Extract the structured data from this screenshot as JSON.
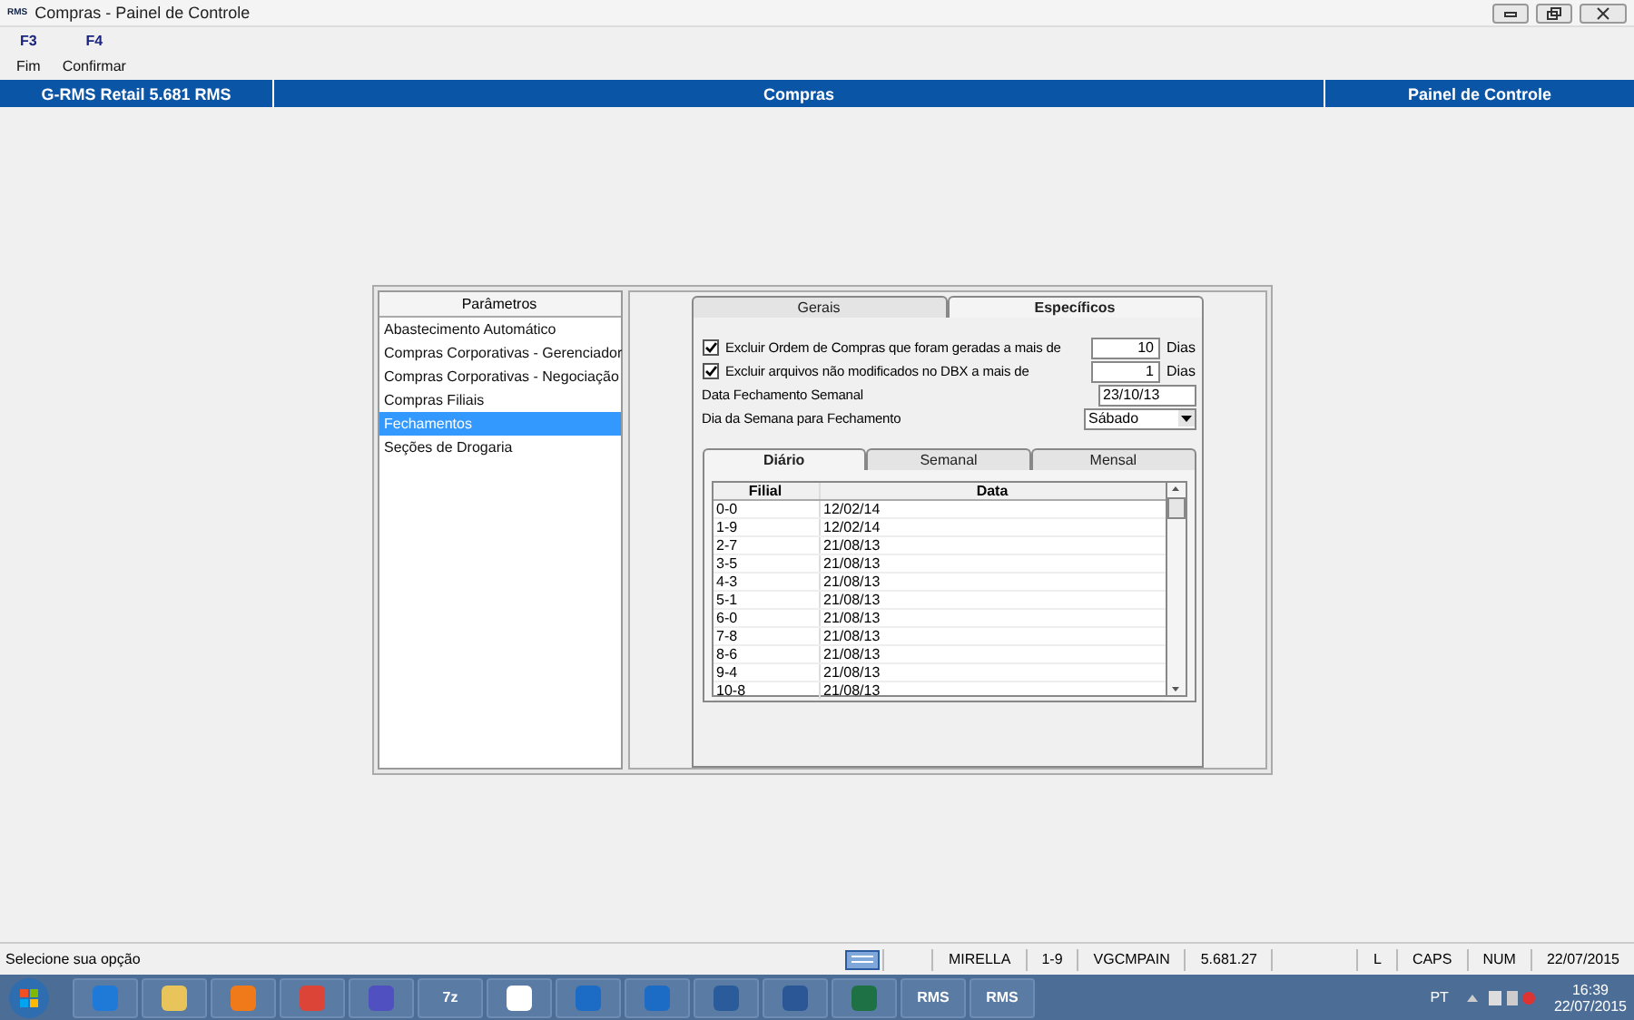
{
  "window": {
    "title": "Compras - Painel de Controle",
    "logo": "RMS"
  },
  "toolbar": [
    {
      "key": "F3",
      "label": "Fim"
    },
    {
      "key": "F4",
      "label": "Confirmar"
    }
  ],
  "header": {
    "left": "G-RMS Retail 5.681 RMS",
    "center": "Compras",
    "right": "Painel de Controle"
  },
  "sidebar": {
    "title": "Parâmetros",
    "items": [
      {
        "label": "Abastecimento Automático",
        "selected": false
      },
      {
        "label": "Compras Corporativas - Gerenciador",
        "selected": false
      },
      {
        "label": "Compras Corporativas - Negociação",
        "selected": false
      },
      {
        "label": "Compras Filiais",
        "selected": false
      },
      {
        "label": "Fechamentos",
        "selected": true
      },
      {
        "label": "Seções de Drogaria",
        "selected": false
      }
    ]
  },
  "tabs": [
    {
      "label": "Gerais",
      "selected": false
    },
    {
      "label": "Específicos",
      "selected": true
    }
  ],
  "options": [
    {
      "kind": "checkbox",
      "label": "Excluir Ordem de Compras que foram geradas a mais de",
      "checked": true,
      "value": "10",
      "unit": "Dias"
    },
    {
      "kind": "checkbox",
      "label": "Excluir arquivos não modificados no DBX a mais de",
      "checked": true,
      "value": "1",
      "unit": "Dias"
    },
    {
      "kind": "date",
      "label": "Data Fechamento Semanal",
      "value": "23/10/13"
    },
    {
      "kind": "select",
      "label": "Dia da Semana para Fechamento",
      "value": "Sábado"
    }
  ],
  "subtabs": [
    {
      "label": "Diário",
      "selected": true
    },
    {
      "label": "Semanal",
      "selected": false
    },
    {
      "label": "Mensal",
      "selected": false
    }
  ],
  "table": {
    "columns": [
      "Filial",
      "Data"
    ],
    "rows": [
      [
        "0-0",
        "12/02/14"
      ],
      [
        "1-9",
        "12/02/14"
      ],
      [
        "2-7",
        "21/08/13"
      ],
      [
        "3-5",
        "21/08/13"
      ],
      [
        "4-3",
        "21/08/13"
      ],
      [
        "5-1",
        "21/08/13"
      ],
      [
        "6-0",
        "21/08/13"
      ],
      [
        "7-8",
        "21/08/13"
      ],
      [
        "8-6",
        "21/08/13"
      ],
      [
        "9-4",
        "21/08/13"
      ],
      [
        "10-8",
        "21/08/13"
      ]
    ]
  },
  "status_bar": {
    "message": "Selecione sua opção",
    "cells": [
      "MIRELLA",
      "1-9",
      "VGCMPAIN",
      "5.681.27",
      "L",
      "CAPS",
      "NUM",
      "22/07/2015"
    ]
  },
  "taskbar": {
    "apps": [
      {
        "kind": "ie"
      },
      {
        "kind": "folder"
      },
      {
        "kind": "media"
      },
      {
        "kind": "chrome"
      },
      {
        "kind": "infinity"
      },
      {
        "kind": "text",
        "label": "7z"
      },
      {
        "kind": "document"
      },
      {
        "kind": "lync"
      },
      {
        "kind": "outlook"
      },
      {
        "kind": "remote"
      },
      {
        "kind": "word"
      },
      {
        "kind": "excel"
      },
      {
        "kind": "text",
        "label": "RMS"
      },
      {
        "kind": "text",
        "label": "RMS"
      }
    ],
    "language": "PT",
    "time": "16:39",
    "date": "22/07/2015"
  }
}
